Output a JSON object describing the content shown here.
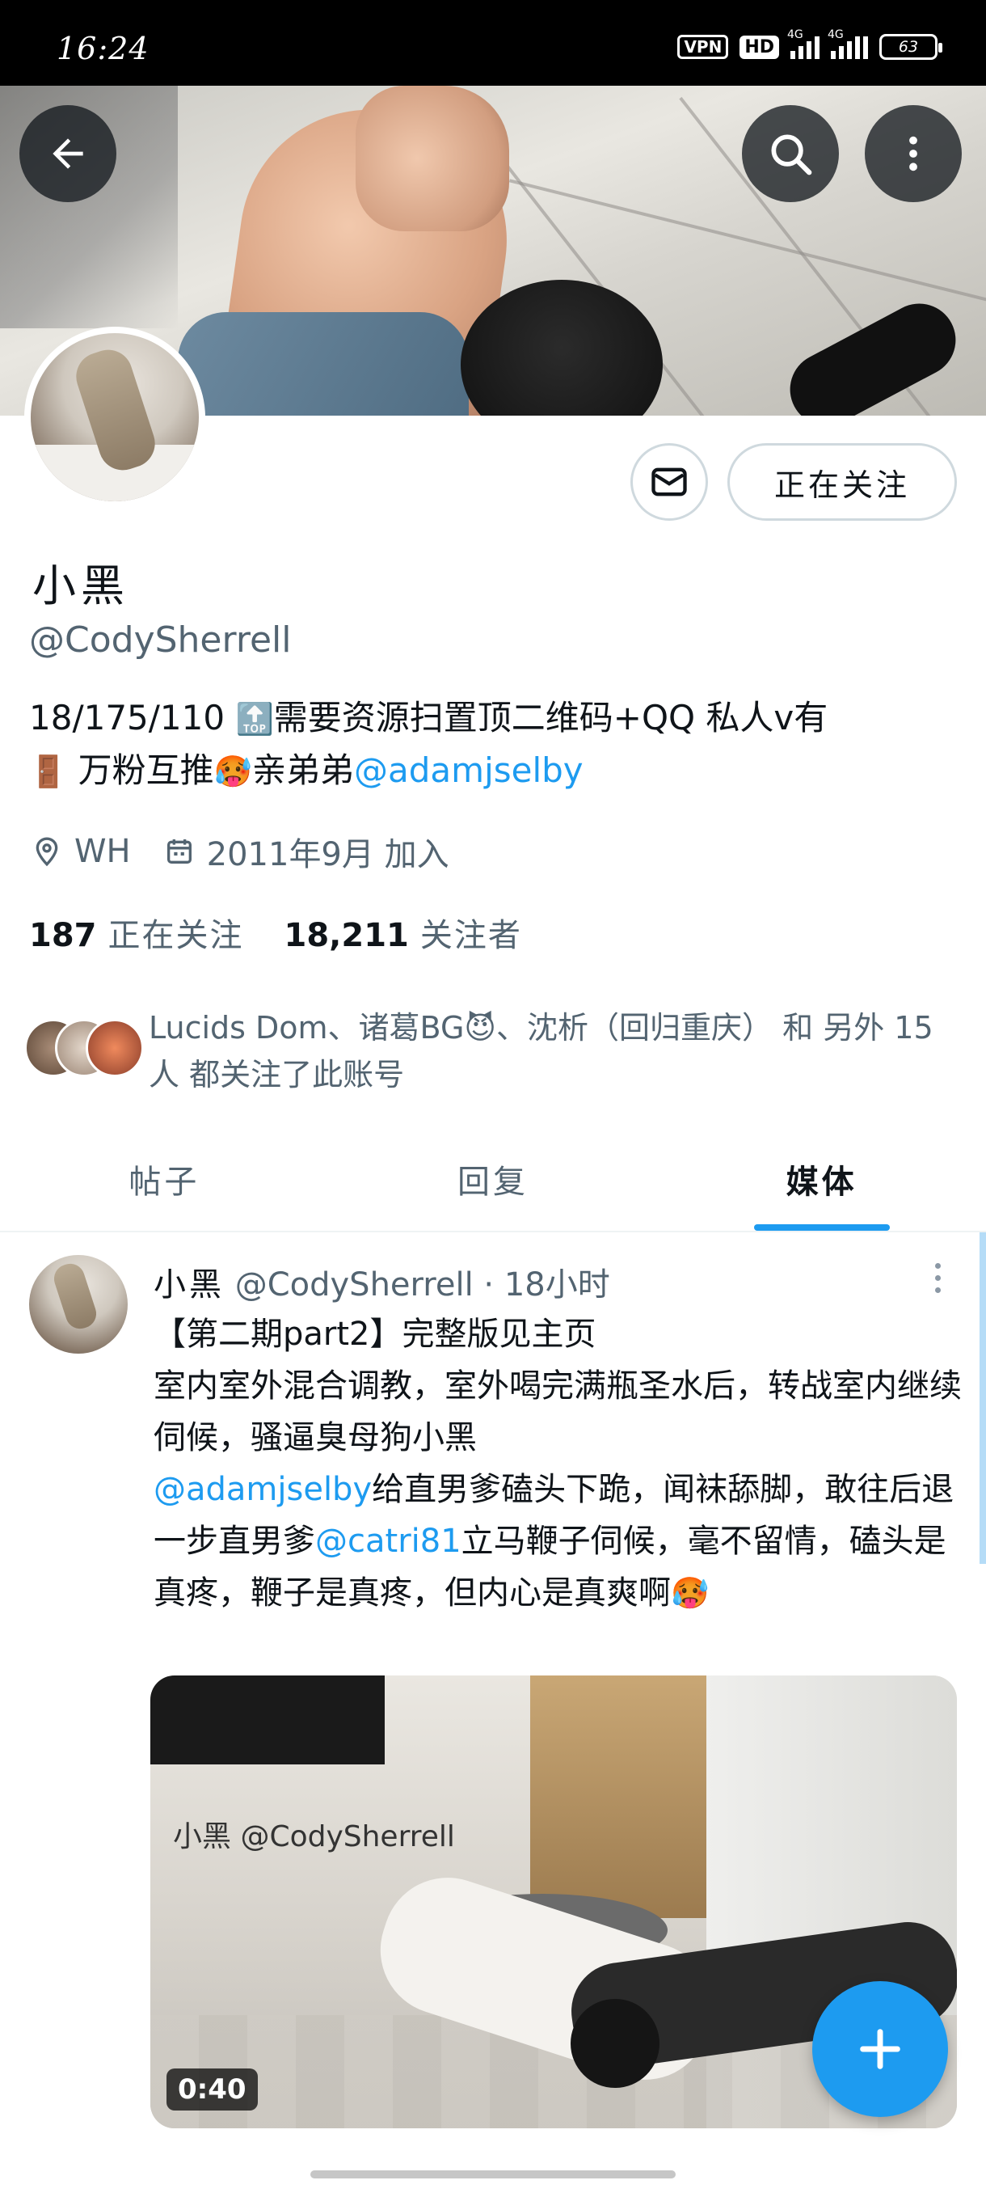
{
  "status_bar": {
    "time": "16:24",
    "vpn": "VPN",
    "hd": "HD",
    "network": "4G",
    "battery": "63"
  },
  "header": {
    "display_name": "小黑",
    "handle": "@CodySherrell",
    "bio_part1": "18/175/110 ",
    "bio_emoji_top": "🔝",
    "bio_part2": "需要资源扫置顶二维码+QQ    私人v有",
    "bio_emoji_door": "🚪",
    "bio_part3": " 万粉互推",
    "bio_emoji_hot": "🥵",
    "bio_part4": "亲弟弟",
    "bio_mention": "@adamjselby",
    "location": "WH",
    "joined": "2011年9月 加入",
    "following_count": "187",
    "following_label": "正在关注",
    "followers_count": "18,211",
    "followers_label": "关注者",
    "followed_by_part1": "Lucids Dom、诸葛BG",
    "followed_by_emoji": "😈",
    "followed_by_part2": "、沈析（回归重庆） 和 另外 15 人 都关注了此账号",
    "follow_button": "正在关注"
  },
  "tabs": [
    {
      "label": "帖子",
      "active": false
    },
    {
      "label": "回复",
      "active": false
    },
    {
      "label": "媒体",
      "active": true
    }
  ],
  "post": {
    "author_name": "小黑",
    "author_handle": "@CodySherrell",
    "time": " · 18小时",
    "line1": "【第二期part2】完整版见主页",
    "line2": "室内室外混合调教，室外喝完满瓶圣水后，转战室内继续伺候，骚逼臭母狗小黑",
    "mention1": "@adamjselby",
    "line3": "给直男爹磕头下跪，闻袜舔脚，敢往后退一步直男爹",
    "mention2": "@catri81",
    "line4": "立马鞭子伺候，毫不留情，磕头是真疼，鞭子是真疼，但内心是真爽啊",
    "emoji": "🥵",
    "video_watermark": "小黑 @CodySherrell",
    "video_duration": "0:40"
  },
  "icons": {
    "back": "arrow-left-icon",
    "search": "search-icon",
    "more": "more-vertical-icon",
    "message": "envelope-icon",
    "location": "location-pin-icon",
    "calendar": "calendar-icon",
    "compose": "plus-icon"
  },
  "colors": {
    "accent": "#1d9bf0",
    "muted": "#536471",
    "text": "#0f1419"
  }
}
